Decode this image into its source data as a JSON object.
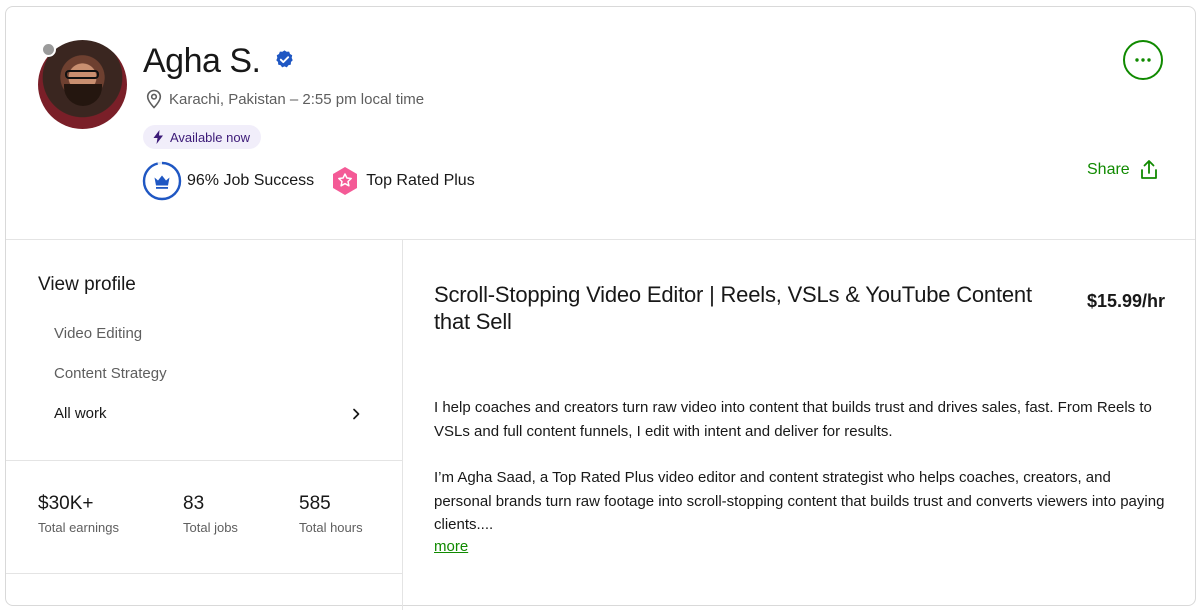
{
  "profile": {
    "name": "Agha S.",
    "location": "Karachi, Pakistan – 2:55 pm local time",
    "availability": "Available now",
    "job_success": "96% Job Success",
    "job_success_value": 0.96,
    "badge": "Top Rated Plus",
    "share_label": "Share"
  },
  "colors": {
    "accent": "#108a00",
    "verified": "#1f57c3",
    "top_rated_plus": "#f45a96",
    "available_bg": "#f1eefa"
  },
  "sidebar": {
    "title": "View profile",
    "items": [
      {
        "label": "Video Editing"
      },
      {
        "label": "Content Strategy"
      },
      {
        "label": "All work"
      }
    ],
    "stats": [
      {
        "value": "$30K+",
        "label": "Total earnings"
      },
      {
        "value": "83",
        "label": "Total jobs"
      },
      {
        "value": "585",
        "label": "Total hours"
      }
    ]
  },
  "main": {
    "title": "Scroll-Stopping Video Editor | Reels, VSLs & YouTube Content that Sell",
    "rate": "$15.99/hr",
    "paragraphs": [
      "I help coaches and creators turn raw video into content that builds trust and drives sales, fast. From Reels to VSLs and full content funnels, I edit with intent and deliver for results.",
      "I’m Agha Saad, a Top Rated Plus video editor and content strategist who helps coaches, creators, and personal brands turn raw footage into scroll-stopping content that builds trust and converts viewers into paying clients...."
    ],
    "more_label": "more"
  }
}
